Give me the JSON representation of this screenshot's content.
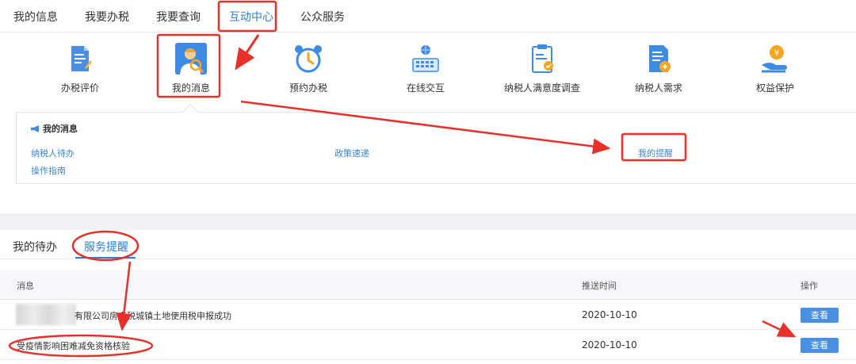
{
  "topnav": {
    "tabs": [
      {
        "label": "我的信息"
      },
      {
        "label": "我要办税"
      },
      {
        "label": "我要查询"
      },
      {
        "label": "互动中心"
      },
      {
        "label": "公众服务"
      }
    ],
    "active_index": 3
  },
  "icons": [
    {
      "label": "办税评价",
      "icon": "tax-evaluation-icon"
    },
    {
      "label": "我的消息",
      "icon": "my-messages-icon"
    },
    {
      "label": "预约办税",
      "icon": "alarm-clock-icon"
    },
    {
      "label": "在线交互",
      "icon": "online-interaction-icon"
    },
    {
      "label": "纳税人满意度调查",
      "icon": "survey-clipboard-icon"
    },
    {
      "label": "纳税人需求",
      "icon": "requirement-document-icon"
    },
    {
      "label": "权益保护",
      "icon": "rights-protection-icon"
    }
  ],
  "messages_panel": {
    "title": "我的消息",
    "links": {
      "todo": "纳税人待办",
      "policy": "政策速递",
      "reminder": "我的提醒",
      "guide": "操作指南"
    }
  },
  "subtabs": {
    "todo": "我的待办",
    "reminder": "服务提醒"
  },
  "table": {
    "headers": {
      "message": "消息",
      "time": "推送时间",
      "action": "操作"
    },
    "rows": [
      {
        "message": "有限公司房产税城镇土地使用税申报成功",
        "time": "2020-10-10",
        "action": "查看"
      },
      {
        "message": "受疫情影响困难减免资格核验",
        "time": "2020-10-10",
        "action": "查看"
      }
    ]
  },
  "colors": {
    "accent": "#2f7fd6",
    "annotation_red": "#e8302a",
    "button_blue": "#4a90e2"
  }
}
